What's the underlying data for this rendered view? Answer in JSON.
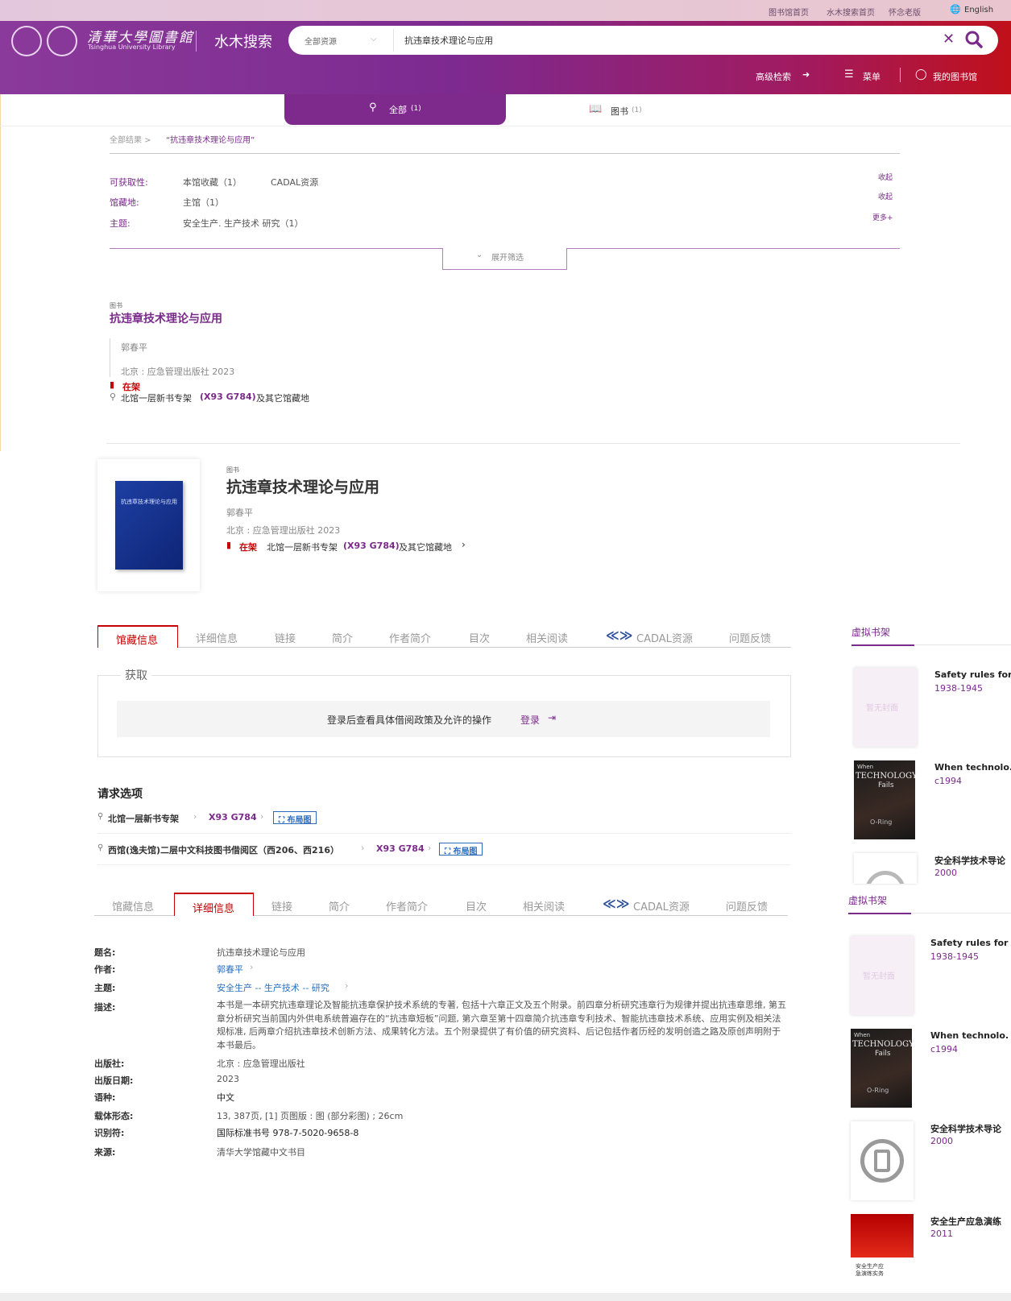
{
  "topbar": {
    "links": [
      "图书馆首页",
      "水木搜索首页",
      "怀念老版",
      "English"
    ]
  },
  "header": {
    "logo_cn": "清華大學圖書館",
    "logo_en": "Tsinghua University Library",
    "site_title": "水木搜索",
    "search_scope": "全部资源",
    "search_query": "抗违章技术理论与应用",
    "advanced_search": "高级检索",
    "menu": "菜单",
    "my_library": "我的图书馆"
  },
  "result_tabs": {
    "all": "全部",
    "all_count": "(1)",
    "books": "图书",
    "books_count": "(1)"
  },
  "breadcrumb": {
    "root": "全部结果 >",
    "query": "“抗违章技术理论与应用”"
  },
  "facets": {
    "availability_label": "可获取性:",
    "availability_values": [
      "本馆收藏（1）",
      "CADAL资源"
    ],
    "location_label": "馆藏地:",
    "location_value": "主馆（1）",
    "subject_label": "主题:",
    "subject_value": "安全生产. 生产技术 研究（1）",
    "collapse": "收起",
    "more": "更多+",
    "expand": "展开筛选"
  },
  "result": {
    "type": "图书",
    "title": "抗违章技术理论与应用",
    "author": "郭春平",
    "publisher": "北京 : 应急管理出版社 2023",
    "status": "在架",
    "location_prefix": "北馆一层新书专架",
    "call_number": "(X93 G784)",
    "location_suffix": "及其它馆藏地"
  },
  "detail": {
    "type": "图书",
    "title": "抗违章技术理论与应用",
    "author": "郭春平",
    "publisher": "北京 : 应急管理出版社  2023",
    "status": "在架",
    "location_prefix": "北馆一层新书专架",
    "call_number": "(X93 G784)",
    "location_suffix": "及其它馆藏地",
    "cover_text": "抗违章技术理论与应用"
  },
  "section_tabs": [
    "馆藏信息",
    "详细信息",
    "链接",
    "简介",
    "作者简介",
    "目次",
    "相关阅读",
    "CADAL资源",
    "问题反馈"
  ],
  "acquire": {
    "title": "获取",
    "notice": "登录后查看具体借阅政策及允许的操作",
    "login": "登录"
  },
  "request": {
    "title": "请求选项",
    "rows": [
      {
        "location": "北馆一层新书专架",
        "call": "X93 G784",
        "map": "布局图"
      },
      {
        "location": "西馆(逸夫馆)二层中文科技图书借阅区（西206、西216）",
        "call": "X93 G784",
        "map": "布局图"
      }
    ]
  },
  "details": {
    "title_label": "题名:",
    "title_value": "抗违章技术理论与应用",
    "author_label": "作者:",
    "author_value": "郭春平",
    "subject_label": "主题:",
    "subject_value": "安全生产 -- 生产技术 -- 研究",
    "desc_label": "描述:",
    "desc_value": "本书是一本研究抗违章理论及智能抗违章保护技术系统的专著, 包括十六章正文及五个附录。前四章分析研究违章行为规律并提出抗违章思维, 第五章分析研究当前国内外供电系统普遍存在的“抗违章短板”问题, 第六章至第十四章简介抗违章专利技术、智能抗违章技术系统、应用实例及相关法规标准, 后两章介绍抗违章技术创新方法、成果转化方法。五个附录提供了有价值的研究资料、后记包括作者历经的发明创造之路及原创声明附于本书最后。",
    "publisher_label": "出版社:",
    "publisher_value": "北京 : 应急管理出版社",
    "date_label": "出版日期:",
    "date_value": "2023",
    "lang_label": "语种:",
    "lang_value": "中文",
    "format_label": "载体形态:",
    "format_value": "13, 387页, [1] 页图版 : 图 (部分彩图) ; 26cm",
    "id_label": "识别符:",
    "id_value": "国际标准书号 978-7-5020-9658-8",
    "source_label": "来源:",
    "source_value": "清华大学馆藏中文书目"
  },
  "virtual_shelf": {
    "title": "虚拟书架",
    "no_cover": "暂无封面",
    "items": [
      {
        "name": "Safety rules for",
        "year": "1938-1945"
      },
      {
        "name": "When technolo.",
        "year": "c1994"
      },
      {
        "name": "安全科学技术导论",
        "year": "2000"
      },
      {
        "name": "安全生产应急演练",
        "year": "2011"
      }
    ],
    "item2_cover": [
      "When",
      "TECHNOLOGY",
      "Fails",
      "O-Ring"
    ],
    "item4_cover": "安全生产应急演练实务"
  }
}
